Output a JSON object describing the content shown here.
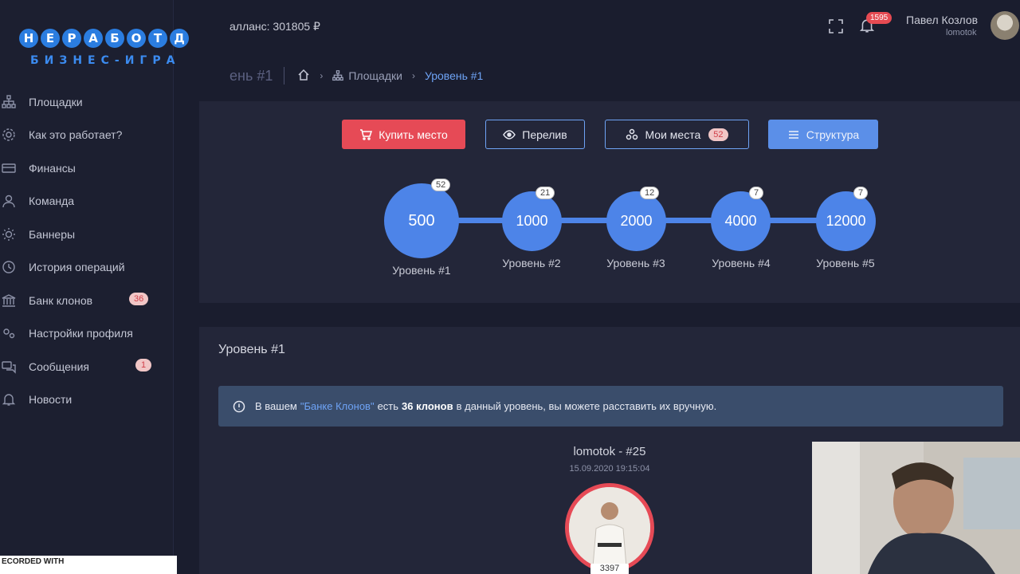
{
  "logo": {
    "letters": [
      "Н",
      "Е",
      "Р",
      "А",
      "Б",
      "О",
      "Т",
      "Д"
    ],
    "subtitle": "БИЗНЕС-ИГРА"
  },
  "header": {
    "balance": "алланс: 301805 ₽",
    "notifications": "1595",
    "user_name": "Павел Козлов",
    "user_login": "lomotok"
  },
  "breadcrumb": {
    "title": "ень #1",
    "home_icon": "home-icon",
    "items": [
      "Площадки",
      "Уровень #1"
    ]
  },
  "sidebar": {
    "items": [
      {
        "label": "Площадки",
        "icon": "sitemap-icon"
      },
      {
        "label": "Как это работает?",
        "icon": "gear-icon"
      },
      {
        "label": "Финансы",
        "icon": "card-icon"
      },
      {
        "label": "Команда",
        "icon": "user-icon"
      },
      {
        "label": "Баннеры",
        "icon": "sun-icon"
      },
      {
        "label": "История операций",
        "icon": "history-icon"
      },
      {
        "label": "Банк клонов",
        "icon": "bank-icon",
        "badge": "36"
      },
      {
        "label": "Настройки профиля",
        "icon": "gears-icon"
      },
      {
        "label": "Сообщения",
        "icon": "chat-icon",
        "badge": "1"
      },
      {
        "label": "Новости",
        "icon": "bell-icon"
      }
    ]
  },
  "actions": {
    "buy": "Купить место",
    "flow": "Перелив",
    "places": "Мои места",
    "places_badge": "52",
    "structure": "Структура"
  },
  "levels": [
    {
      "value": "500",
      "badge": "52",
      "label": "Уровень #1"
    },
    {
      "value": "1000",
      "badge": "21",
      "label": "Уровень #2"
    },
    {
      "value": "2000",
      "badge": "12",
      "label": "Уровень #3"
    },
    {
      "value": "4000",
      "badge": "7",
      "label": "Уровень #4"
    },
    {
      "value": "12000",
      "badge": "7",
      "label": "Уровень #5"
    }
  ],
  "section": {
    "title": "Уровень #1",
    "alert_pre": "В вашем",
    "alert_link": "\"Банке Клонов\"",
    "alert_mid": "есть",
    "alert_bold": "36 клонов",
    "alert_post": "в данный уровень, вы можете расставить их вручную.",
    "member_name": "lomotok - #25",
    "member_date": "15.09.2020 19:15:04",
    "member_count": "3397"
  },
  "overlay": {
    "watermark": "ECORDED WITH"
  },
  "colors": {
    "accent": "#4d84e8",
    "danger": "#e64a56",
    "bg": "#1a1d2e",
    "card": "#232639"
  }
}
